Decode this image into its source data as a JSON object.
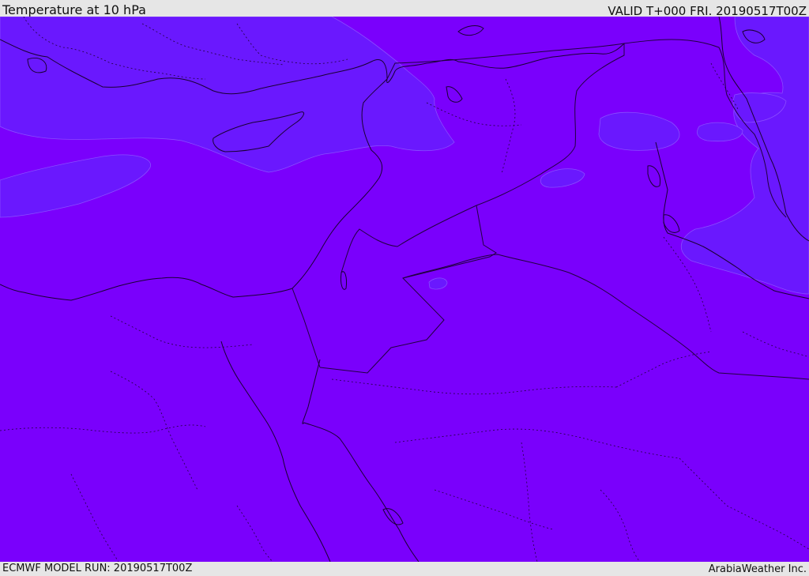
{
  "header": {
    "title": "Temperature at 10 hPa",
    "valid": "VALID T+000 FRI. 20190517T00Z"
  },
  "footer": {
    "model_run": "ECMWF MODEL RUN: 20190517T00Z",
    "credit": "ArabiaWeather Inc."
  },
  "colors": {
    "field_main": "#7a00fc",
    "field_warm_band": "#6a18fe",
    "band_edge": "#8a4cff",
    "coastline": "#1a0033",
    "border": "#22003f"
  }
}
